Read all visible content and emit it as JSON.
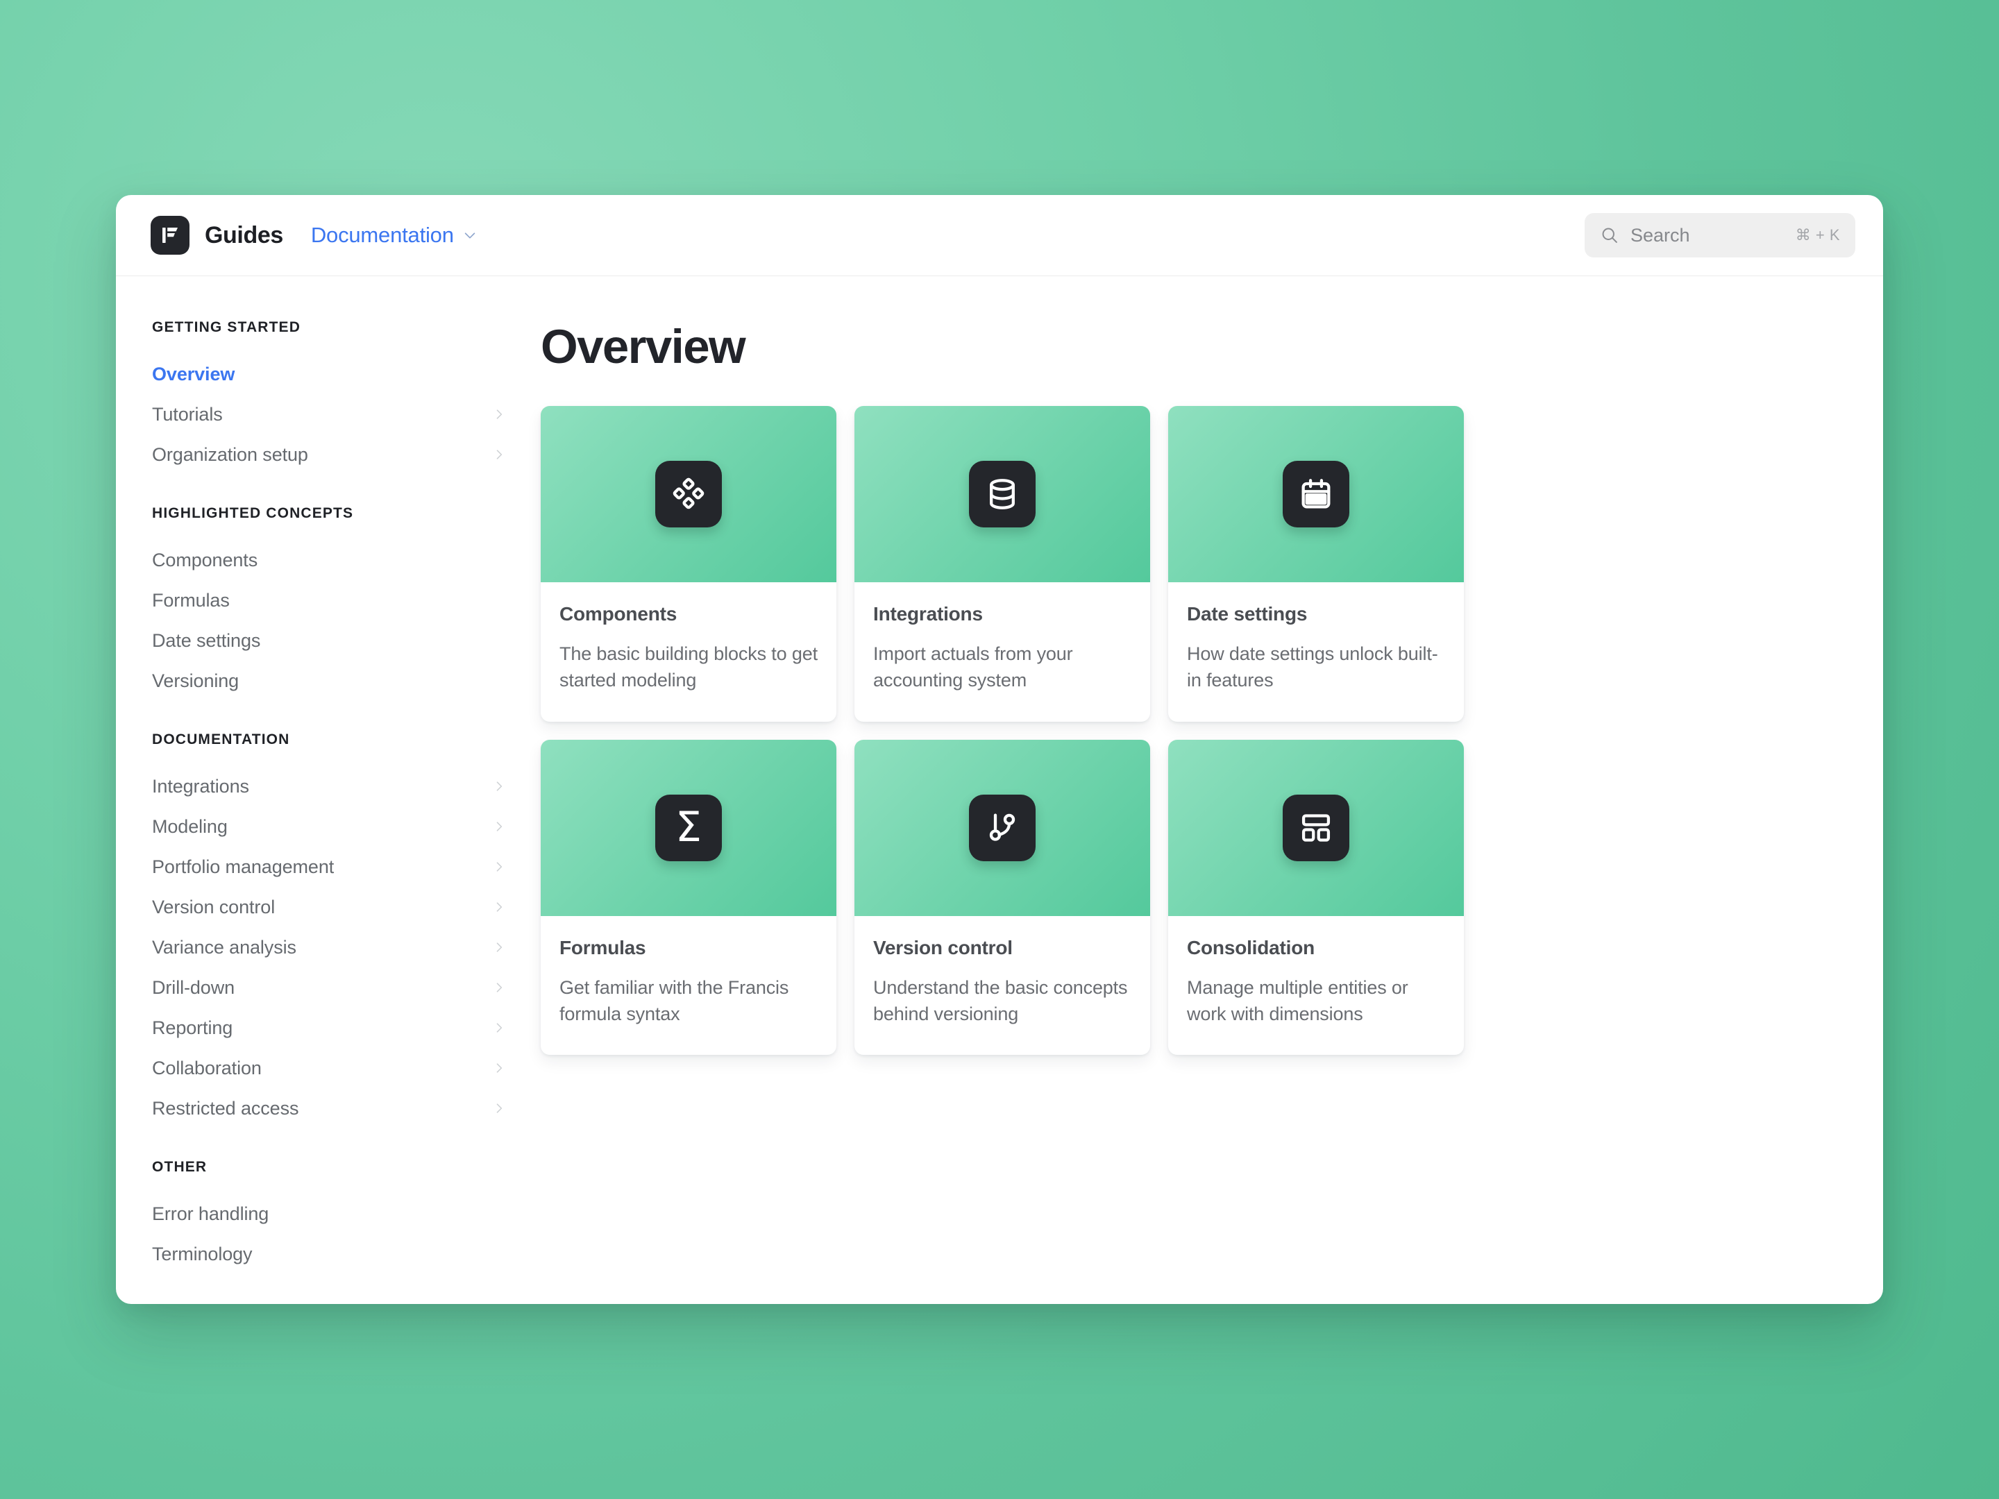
{
  "header": {
    "brand_name": "Guides",
    "logo_icon": "francis-logo-icon",
    "section_label": "Documentation",
    "section_chevron_icon": "chevron-down-icon"
  },
  "search": {
    "icon": "search-icon",
    "placeholder": "Search",
    "shortcut": "⌘ + K"
  },
  "sidebar": {
    "groups": [
      {
        "heading": "GETTING STARTED",
        "items": [
          {
            "label": "Overview",
            "active": true,
            "chevron": false
          },
          {
            "label": "Tutorials",
            "active": false,
            "chevron": true
          },
          {
            "label": "Organization setup",
            "active": false,
            "chevron": true
          }
        ]
      },
      {
        "heading": "HIGHLIGHTED CONCEPTS",
        "items": [
          {
            "label": "Components",
            "active": false,
            "chevron": false
          },
          {
            "label": "Formulas",
            "active": false,
            "chevron": false
          },
          {
            "label": "Date settings",
            "active": false,
            "chevron": false
          },
          {
            "label": "Versioning",
            "active": false,
            "chevron": false
          }
        ]
      },
      {
        "heading": "DOCUMENTATION",
        "items": [
          {
            "label": "Integrations",
            "active": false,
            "chevron": true
          },
          {
            "label": "Modeling",
            "active": false,
            "chevron": true
          },
          {
            "label": "Portfolio management",
            "active": false,
            "chevron": true
          },
          {
            "label": "Version control",
            "active": false,
            "chevron": true
          },
          {
            "label": "Variance analysis",
            "active": false,
            "chevron": true
          },
          {
            "label": "Drill-down",
            "active": false,
            "chevron": true
          },
          {
            "label": "Reporting",
            "active": false,
            "chevron": true
          },
          {
            "label": "Collaboration",
            "active": false,
            "chevron": true
          },
          {
            "label": "Restricted access",
            "active": false,
            "chevron": true
          }
        ]
      },
      {
        "heading": "OTHER",
        "items": [
          {
            "label": "Error handling",
            "active": false,
            "chevron": false
          },
          {
            "label": "Terminology",
            "active": false,
            "chevron": false
          }
        ]
      }
    ]
  },
  "main": {
    "page_title": "Overview",
    "cards": [
      {
        "icon": "blocks-diamond-icon",
        "title": "Components",
        "description": "The basic building blocks to get started modeling"
      },
      {
        "icon": "database-icon",
        "title": "Integrations",
        "description": "Import actuals from your accounting system"
      },
      {
        "icon": "calendar-icon",
        "title": "Date settings",
        "description": "How date settings unlock built-in features"
      },
      {
        "icon": "sigma-icon",
        "title": "Formulas",
        "description": "Get familiar with the Francis formula syntax"
      },
      {
        "icon": "git-branch-icon",
        "title": "Version control",
        "description": "Understand the basic concepts behind versioning"
      },
      {
        "icon": "layout-dashboard-icon",
        "title": "Consolidation",
        "description": "Manage multiple entities or work with dimensions"
      }
    ]
  },
  "colors": {
    "accent_blue": "#3b76f0",
    "tile_dark": "#24262b",
    "thumb_gradient_start": "#8fe0bf",
    "thumb_gradient_end": "#54c99c",
    "page_background": "#5fc49c"
  }
}
